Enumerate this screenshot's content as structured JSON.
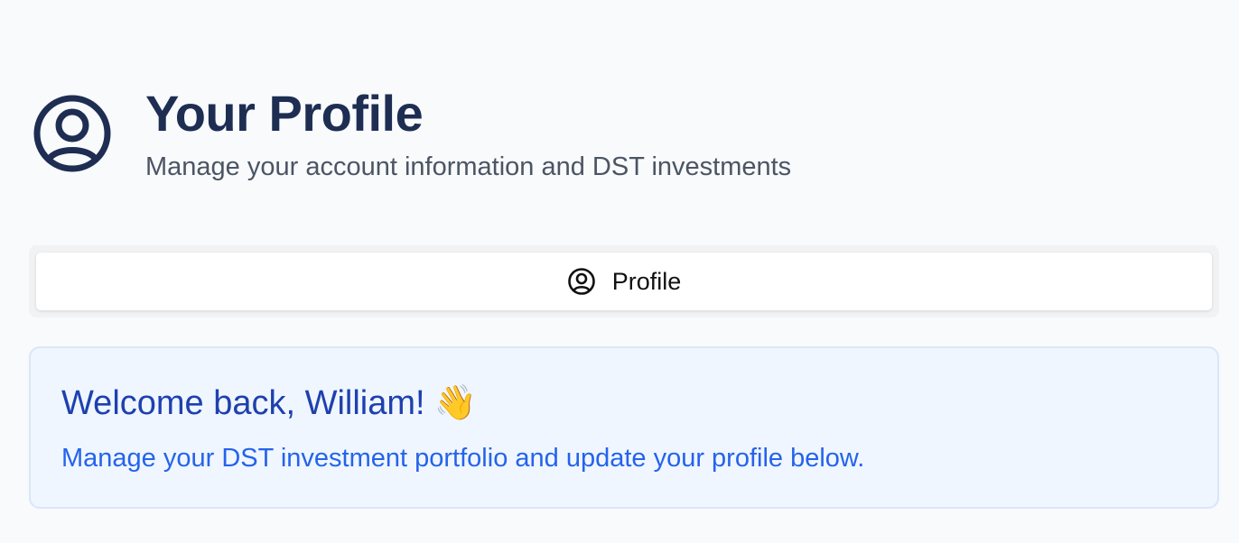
{
  "header": {
    "icon": "user-circle-icon",
    "title": "Your Profile",
    "subtitle": "Manage your account information and DST investments"
  },
  "tabs": [
    {
      "label": "Profile",
      "icon": "user-circle-icon",
      "active": true
    }
  ],
  "welcome": {
    "title": "Welcome back, William!",
    "emoji": "👋",
    "message": "Manage your DST investment portfolio and update your profile below."
  },
  "colors": {
    "title": "#1e2d52",
    "welcome_title": "#1e40af",
    "welcome_text": "#2563eb",
    "welcome_bg": "#eff6ff"
  }
}
